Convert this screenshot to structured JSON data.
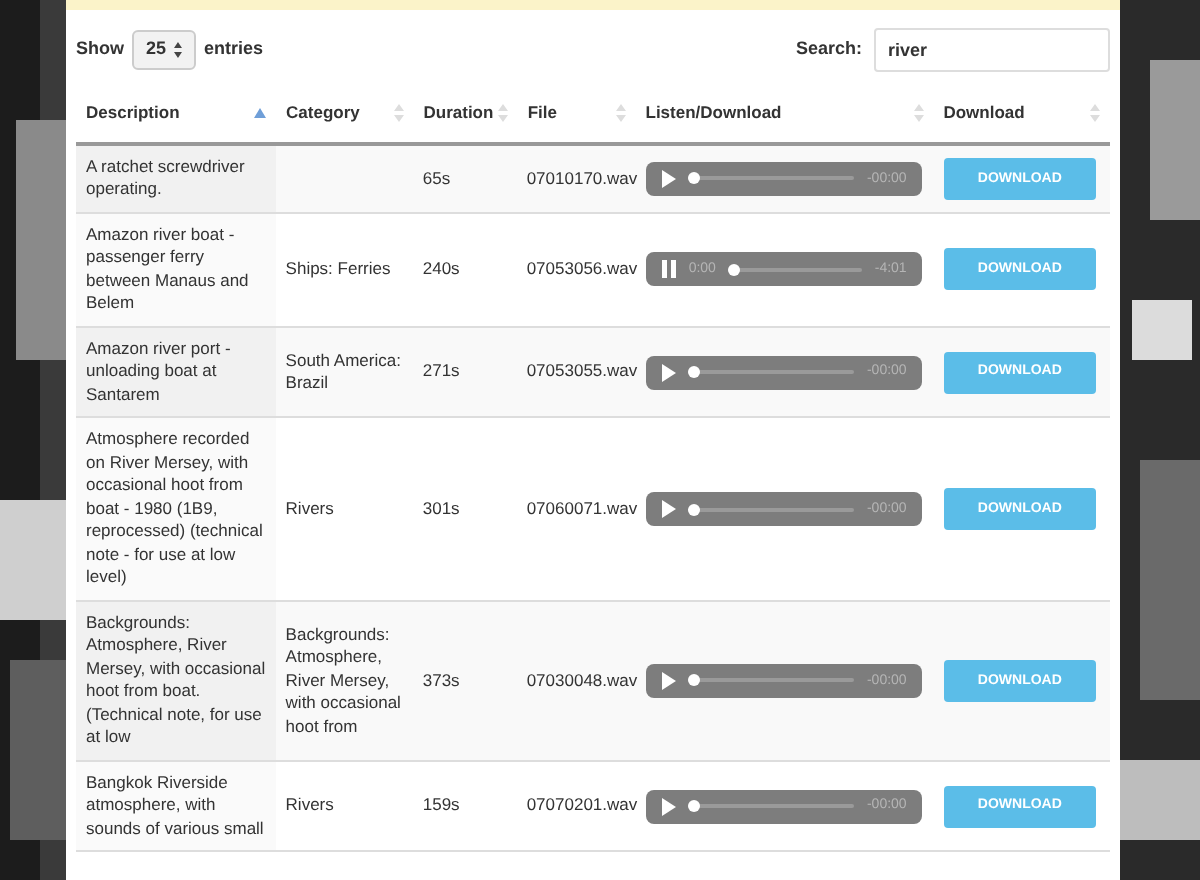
{
  "length_menu": {
    "label_before": "Show",
    "value": "25",
    "label_after": "entries"
  },
  "search": {
    "label": "Search:",
    "value": "river"
  },
  "columns": [
    {
      "label": "Description",
      "sorted": true
    },
    {
      "label": "Category",
      "sorted": false
    },
    {
      "label": "Duration",
      "sorted": false
    },
    {
      "label": "File",
      "sorted": false
    },
    {
      "label": "Listen/Download",
      "sorted": false
    },
    {
      "label": "Download",
      "sorted": false
    }
  ],
  "rows": [
    {
      "description": "A ratchet screwdriver operating.",
      "duration": "65s",
      "file": "07010170.wav",
      "player": {
        "playing": false,
        "remaining": "-00:00"
      },
      "button": "DOWNLOAD"
    },
    {
      "description": "Amazon river boat - passenger ferry between Manaus and Belem",
      "category": "Ships: Ferries",
      "duration": "240s",
      "file": "07053056.wav",
      "player": {
        "playing": true,
        "elapsed": "0:00",
        "remaining": "-4:01"
      },
      "button": "DOWNLOAD"
    },
    {
      "description": "Amazon river port - unloading boat at Santarem",
      "category": "South America: Brazil",
      "duration": "271s",
      "file": "07053055.wav",
      "player": {
        "playing": false,
        "remaining": "-00:00"
      },
      "button": "DOWNLOAD"
    },
    {
      "description": "Atmosphere recorded on River Mersey, with occasional hoot from boat - 1980 (1B9, reprocessed) (technical note - for use at low level)",
      "category": "Rivers",
      "duration": "301s",
      "file": "07060071.wav",
      "player": {
        "playing": false,
        "remaining": "-00:00"
      },
      "button": "DOWNLOAD"
    },
    {
      "description": "Backgrounds: Atmosphere, River Mersey, with occasional hoot from boat. (Technical note, for use at low",
      "category": "Backgrounds: Atmosphere, River Mersey, with occasional hoot from",
      "duration": "373s",
      "file": "07030048.wav",
      "player": {
        "playing": false,
        "remaining": "-00:00"
      },
      "button": "DOWNLOAD"
    },
    {
      "description": "Bangkok Riverside atmosphere, with sounds of various small",
      "category": "Rivers",
      "duration": "159s",
      "file": "07070201.wav",
      "player": {
        "playing": false,
        "remaining": "-00:00"
      },
      "button": "DOWNLOAD"
    }
  ]
}
